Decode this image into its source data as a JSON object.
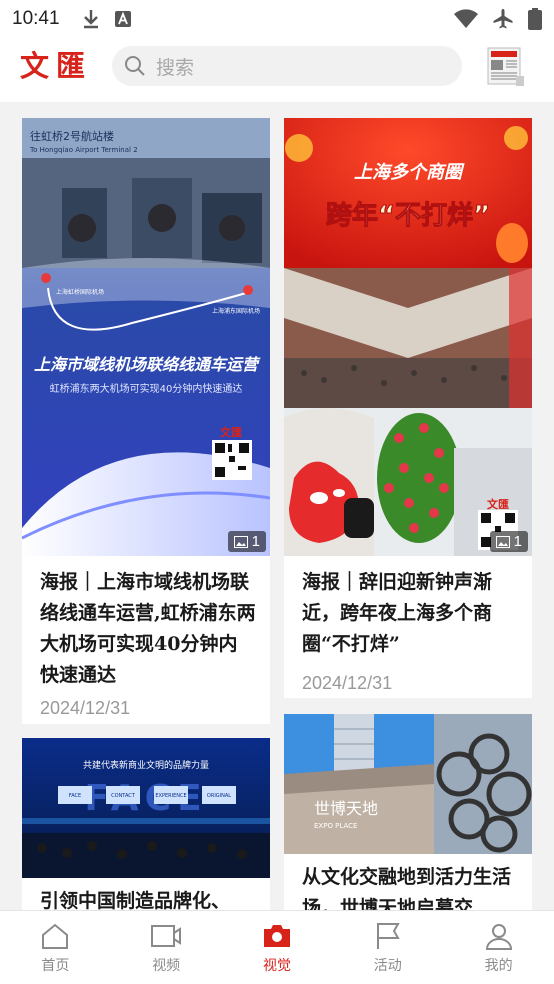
{
  "status": {
    "time": "10:41"
  },
  "header": {
    "logo": "文匯",
    "search_placeholder": "搜索"
  },
  "cards": [
    {
      "title": "海报｜上海市域线机场联络线通车运营,虹桥浦东两大机场可实现40分钟内快速通达",
      "date": "2024/12/31",
      "image_count": "1",
      "poster_title": "上海市域线机场联络线通车运营",
      "poster_subtitle": "虹桥浦东两大机场可实现40分钟内快速通达",
      "station_a": "上海虹桥国际机场",
      "station_b": "上海浦东国际机场",
      "sign_text": "往虹桥2号航站楼",
      "sign_en": "To Hongqiao Airport Terminal 2",
      "logo_small": "文匯"
    },
    {
      "title": "海报｜辞旧迎新钟声渐近，跨年夜上海多个商圈“不打烊”",
      "date": "2024/12/31",
      "image_count": "1",
      "poster_title_1": "上海多个商圈",
      "poster_title_2": "跨年“不打烊”",
      "logo_small": "文匯"
    },
    {
      "title": "引领中国制造品牌化、",
      "banner_text": "共建代表新商业文明的品牌力量",
      "banner_sub": "FACE",
      "board_items": [
        "FACE",
        "CONTACT",
        "EXPERIENCE",
        "ORIGINAL"
      ]
    },
    {
      "title": "从文化交融地到活力生活场，世博天地启幕交",
      "sign_text": "世博天地",
      "sign_en": "EXPO PLACE"
    }
  ],
  "tabs": [
    {
      "label": "首页",
      "icon": "home-icon",
      "active": false
    },
    {
      "label": "视频",
      "icon": "video-icon",
      "active": false
    },
    {
      "label": "视觉",
      "icon": "camera-icon",
      "active": true
    },
    {
      "label": "活动",
      "icon": "flag-icon",
      "active": false
    },
    {
      "label": "我的",
      "icon": "person-icon",
      "active": false
    }
  ],
  "colors": {
    "brand": "#d8231a",
    "inactive": "#8a8a8a"
  }
}
